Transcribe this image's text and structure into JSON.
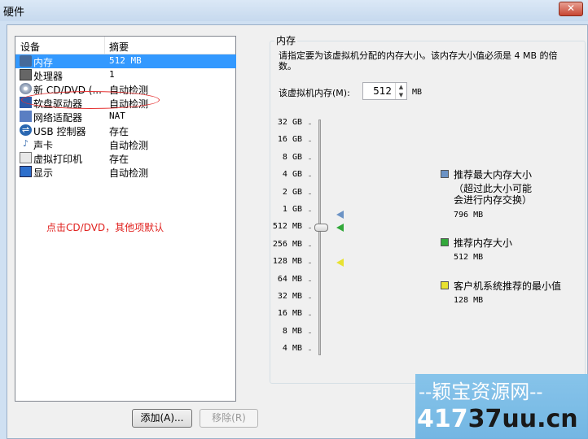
{
  "window": {
    "title": "硬件",
    "close_glyph": "✕"
  },
  "device_list": {
    "col_device": "设备",
    "col_summary": "摘要",
    "rows": [
      {
        "icon": "memory-icon",
        "name": "内存",
        "summary": "512 MB",
        "selected": true
      },
      {
        "icon": "processor-icon",
        "name": "处理器",
        "summary": "1"
      },
      {
        "icon": "cd-dvd-icon",
        "name": "新 CD/DVD (...",
        "summary": "自动检测"
      },
      {
        "icon": "floppy-icon",
        "name": "软盘驱动器",
        "summary": "自动检测"
      },
      {
        "icon": "network-adapter-icon",
        "name": "网络适配器",
        "summary": "NAT"
      },
      {
        "icon": "usb-icon",
        "name": "USB 控制器",
        "summary": "存在"
      },
      {
        "icon": "sound-card-icon",
        "name": "声卡",
        "summary": "自动检测"
      },
      {
        "icon": "printer-icon",
        "name": "虚拟打印机",
        "summary": "存在"
      },
      {
        "icon": "display-icon",
        "name": "显示",
        "summary": "自动检测"
      }
    ]
  },
  "annotation": "点击CD/DVD，其他项默认",
  "buttons": {
    "add": "添加(A)...",
    "remove": "移除(R)"
  },
  "memory": {
    "group_title": "内存",
    "description": "请指定要为该虚拟机分配的内存大小。该内存大小值必须是 4 MB 的倍数。",
    "field_label": "该虚拟机内存(M):",
    "value": "512",
    "unit": "MB",
    "scale_ticks": [
      "32 GB",
      "16 GB",
      "8 GB",
      "4 GB",
      "2 GB",
      "1 GB",
      "512 MB",
      "256 MB",
      "128 MB",
      "64 MB",
      "32 MB",
      "16 MB",
      "8 MB",
      "4 MB"
    ],
    "legend": [
      {
        "color": "#6c93c5",
        "label": "推荐最大内存大小",
        "note": "（超过此大小可能\n会进行内存交换）",
        "value": "796 MB"
      },
      {
        "color": "#32a83a",
        "label": "推荐内存大小",
        "value": "512 MB"
      },
      {
        "color": "#e8e232",
        "label": "客户机系统推荐的最小值",
        "value": "128 MB"
      }
    ]
  },
  "watermark": {
    "line1": "--颖宝资源网--",
    "line2a": "417",
    "line2b": "37uu.cn"
  }
}
